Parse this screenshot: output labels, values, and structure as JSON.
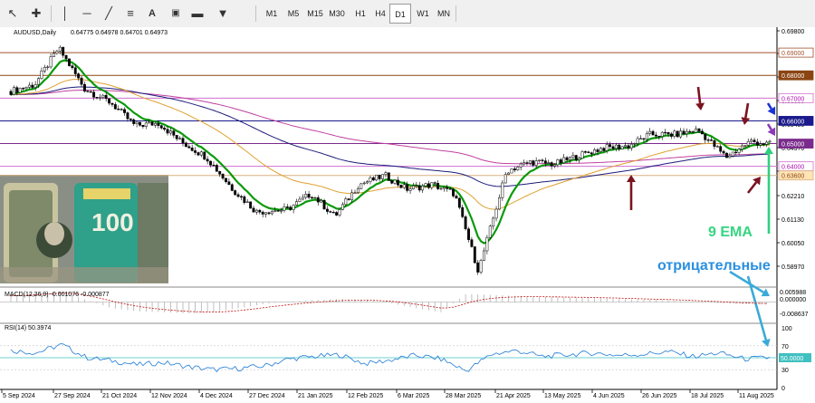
{
  "toolbar": {
    "tools": [
      "cursor-icon",
      "crosshair-icon",
      "vertical-line-icon",
      "horizontal-line-icon",
      "trendline-icon",
      "fibonacci-icon",
      "text-icon",
      "text-label-icon",
      "rectangle-icon",
      "shapes-icon"
    ],
    "timeframes": [
      "M1",
      "M5",
      "M15",
      "M30",
      "H1",
      "H4",
      "D1",
      "W1",
      "MN"
    ],
    "active_timeframe": "D1"
  },
  "chart": {
    "header_symbol": "AUDUSD,Daily",
    "header_ohlc": "0.64775 0.64978 0.64701 0.64973"
  },
  "price_axis": {
    "ticks": [
      "0.69800",
      "0.68720",
      "0.67635",
      "0.66555",
      "0.65450",
      "0.64370",
      "0.63290",
      "0.62210",
      "0.61130",
      "0.60050",
      "0.58970"
    ],
    "boxes": [
      {
        "label": "0.69000",
        "price": 0.69,
        "bg": "#ffffff",
        "fg": "#a0522d",
        "border": "#a0522d"
      },
      {
        "label": "0.68000",
        "price": 0.68,
        "bg": "#8b4513",
        "fg": "#ffffff",
        "border": "#8b4513"
      },
      {
        "label": "0.67000",
        "price": 0.67,
        "bg": "#ffffff",
        "fg": "#b00bb0",
        "border": "#d070d0"
      },
      {
        "label": "0.66000",
        "price": 0.66,
        "bg": "#1a1a8c",
        "fg": "#ffffff",
        "border": "#1a1a8c"
      },
      {
        "label": "0.65000",
        "price": 0.65,
        "bg": "#7a2a8c",
        "fg": "#ffffff",
        "border": "#7a2a8c"
      },
      {
        "label": "0.64000",
        "price": 0.64,
        "bg": "#ffffff",
        "fg": "#b00bb0",
        "border": "#d070d0"
      },
      {
        "label": "0.63600",
        "price": 0.636,
        "bg": "#ffe4b5",
        "fg": "#8b4513",
        "border": "#d8b080"
      }
    ]
  },
  "macd": {
    "header": "MACD(12,26,9) -0.001076 -0.000877",
    "ticks": [
      "0.005988",
      "0.000000",
      "-0.008637"
    ]
  },
  "rsi": {
    "header": "RSI(14) 50.3974",
    "ticks": [
      "100",
      "70",
      "50.0000",
      "30",
      "0"
    ]
  },
  "time_axis": [
    "5 Sep 2024",
    "27 Sep 2024",
    "21 Oct 2024",
    "12 Nov 2024",
    "4 Dec 2024",
    "27 Dec 2024",
    "21 Jan 2025",
    "12 Feb 2025",
    "6 Mar 2025",
    "28 Mar 2025",
    "21 Apr 2025",
    "13 May 2025",
    "4 Jun 2025",
    "26 Jun 2025",
    "18 Jul 2025",
    "11 Aug 2025"
  ],
  "annotations": {
    "ema_label": "9 EMA",
    "negative_label": "отрицательные"
  },
  "colors": {
    "ema_green": "#0a9a0a",
    "ema_orange": "#e0a030",
    "ema_navy": "#1c1c7a",
    "ema_magenta": "#c040a0",
    "arrow_red": "#7a1420",
    "arrow_blue": "#1a33d6",
    "arrow_purple": "#8a3ab8",
    "arrow_cyan": "#3aaad8",
    "arrow_green": "#30d080"
  },
  "chart_data": {
    "type": "line",
    "x_range": [
      "2024-09-05",
      "2025-08-20"
    ],
    "ylim": [
      0.5897,
      0.698
    ],
    "horizontal_levels": [
      0.69,
      0.68,
      0.67,
      0.66,
      0.65,
      0.64,
      0.636
    ],
    "price_series": [
      {
        "date": "2024-09-05",
        "close": 0.673
      },
      {
        "date": "2024-09-16",
        "close": 0.676
      },
      {
        "date": "2024-09-27",
        "close": 0.692
      },
      {
        "date": "2024-10-09",
        "close": 0.674
      },
      {
        "date": "2024-10-21",
        "close": 0.668
      },
      {
        "date": "2024-11-01",
        "close": 0.658
      },
      {
        "date": "2024-11-12",
        "close": 0.659
      },
      {
        "date": "2024-11-22",
        "close": 0.651
      },
      {
        "date": "2024-12-04",
        "close": 0.644
      },
      {
        "date": "2024-12-16",
        "close": 0.63
      },
      {
        "date": "2024-12-27",
        "close": 0.62
      },
      {
        "date": "2025-01-10",
        "close": 0.621
      },
      {
        "date": "2025-01-21",
        "close": 0.628
      },
      {
        "date": "2025-02-01",
        "close": 0.618
      },
      {
        "date": "2025-02-12",
        "close": 0.632
      },
      {
        "date": "2025-02-24",
        "close": 0.636
      },
      {
        "date": "2025-03-06",
        "close": 0.63
      },
      {
        "date": "2025-03-18",
        "close": 0.632
      },
      {
        "date": "2025-03-28",
        "close": 0.628
      },
      {
        "date": "2025-04-08",
        "close": 0.594
      },
      {
        "date": "2025-04-21",
        "close": 0.638
      },
      {
        "date": "2025-05-02",
        "close": 0.642
      },
      {
        "date": "2025-05-13",
        "close": 0.641
      },
      {
        "date": "2025-05-25",
        "close": 0.645
      },
      {
        "date": "2025-06-04",
        "close": 0.648
      },
      {
        "date": "2025-06-16",
        "close": 0.649
      },
      {
        "date": "2025-06-26",
        "close": 0.654
      },
      {
        "date": "2025-07-08",
        "close": 0.654
      },
      {
        "date": "2025-07-18",
        "close": 0.656
      },
      {
        "date": "2025-07-31",
        "close": 0.644
      },
      {
        "date": "2025-08-11",
        "close": 0.651
      },
      {
        "date": "2025-08-20",
        "close": 0.6497
      }
    ],
    "series": [
      {
        "name": "9 EMA",
        "color": "#0a9a0a"
      },
      {
        "color": "#e0a030"
      },
      {
        "color": "#1c1c7a"
      },
      {
        "color": "#c040a0"
      }
    ],
    "macd": {
      "ylim": [
        -0.008637,
        0.005988
      ],
      "values": [
        0.003,
        0.0045,
        0.0052,
        0.001,
        -0.003,
        -0.0045,
        -0.005,
        -0.0055,
        -0.005,
        -0.003,
        -0.001,
        0.0002,
        0.001,
        0.0015,
        0.001,
        -0.0005,
        -0.003,
        -0.005,
        0.004,
        0.0035,
        0.003,
        0.0025,
        0.0022,
        0.002,
        0.0015,
        0.0012,
        0.0008,
        0.0002,
        -0.0005,
        -0.001,
        -0.0011
      ]
    },
    "rsi": {
      "ylim": [
        0,
        100
      ],
      "level": 50,
      "values": [
        62,
        58,
        72,
        50,
        45,
        38,
        42,
        35,
        30,
        32,
        36,
        48,
        52,
        55,
        40,
        46,
        54,
        48,
        28,
        56,
        62,
        52,
        55,
        58,
        54,
        56,
        60,
        52,
        58,
        48,
        50
      ]
    }
  }
}
